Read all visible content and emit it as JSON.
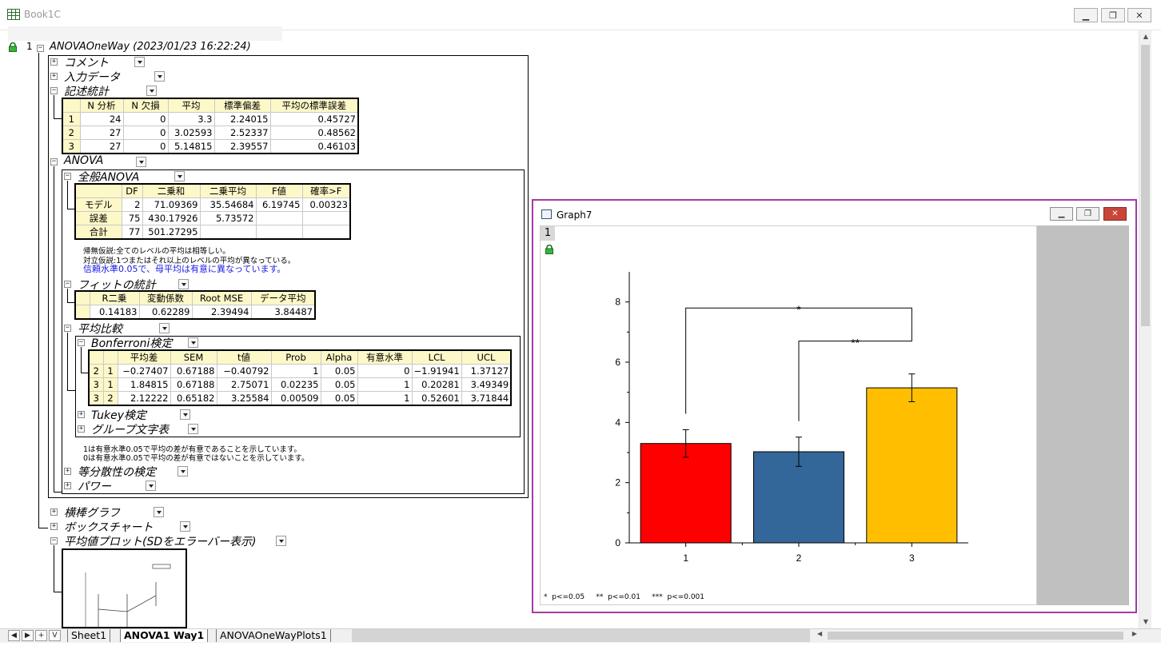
{
  "window": {
    "title": "Book1C"
  },
  "report": {
    "index": "1",
    "title": "ANOVAOneWay (2023/01/23 16:22:24)",
    "nodes": {
      "comment": "コメント",
      "input": "入力データ",
      "descriptive": "記述統計",
      "anova": "ANOVA",
      "overall_anova": "全般ANOVA",
      "fit_stats": "フィットの統計",
      "means_comparison": "平均比較",
      "bonferroni": "Bonferroni検定",
      "tukey": "Tukey検定",
      "group_letters": "グループ文字表",
      "homogeneity": "等分散性の検定",
      "power": "パワー",
      "bar_graph": "横棒グラフ",
      "box_chart": "ボックスチャート",
      "means_plot": "平均値プロット(SDをエラーバー表示)"
    },
    "descriptive_table": {
      "headers": [
        "N 分析",
        "N 欠損",
        "平均",
        "標準偏差",
        "平均の標準誤差"
      ],
      "rows": [
        [
          "1",
          "24",
          "0",
          "3.3",
          "2.24015",
          "0.45727"
        ],
        [
          "2",
          "27",
          "0",
          "3.02593",
          "2.52337",
          "0.48562"
        ],
        [
          "3",
          "27",
          "0",
          "5.14815",
          "2.39557",
          "0.46103"
        ]
      ]
    },
    "anova_table": {
      "headers": [
        "DF",
        "二乗和",
        "二乗平均",
        "F値",
        "確率>F"
      ],
      "rows": [
        [
          "モデル",
          "2",
          "71.09369",
          "35.54684",
          "6.19745",
          "0.00323"
        ],
        [
          "誤差",
          "75",
          "430.17926",
          "5.73572",
          "",
          ""
        ],
        [
          "合計",
          "77",
          "501.27295",
          "",
          "",
          ""
        ]
      ]
    },
    "anova_notes": {
      "null": "帰無仮説:全てのレベルの平均は相等しい。",
      "alt": "対立仮説:1つまたはそれ以上のレベルの平均が異なっている。",
      "conclusion": "信頼水準0.05で、母平均は有意に異なっています。"
    },
    "fit_table": {
      "headers": [
        "R二乗",
        "変動係数",
        "Root MSE",
        "データ平均"
      ],
      "row": [
        "0.14183",
        "0.62289",
        "2.39494",
        "3.84487"
      ]
    },
    "bonferroni_table": {
      "headers": [
        "平均差",
        "SEM",
        "t値",
        "Prob",
        "Alpha",
        "有意水準",
        "LCL",
        "UCL"
      ],
      "rows": [
        [
          "2",
          "1",
          "−0.27407",
          "0.67188",
          "−0.40792",
          "1",
          "0.05",
          "0",
          "−1.91941",
          "1.37127"
        ],
        [
          "3",
          "1",
          "1.84815",
          "0.67188",
          "2.75071",
          "0.02235",
          "0.05",
          "1",
          "0.20281",
          "3.49349"
        ],
        [
          "3",
          "2",
          "2.12222",
          "0.65182",
          "3.25584",
          "0.00509",
          "0.05",
          "1",
          "0.52601",
          "3.71844"
        ]
      ]
    },
    "sig_notes": {
      "line1": "1は有意水準0.05で平均の差が有意であることを示しています。",
      "line2": "0は有意水準0.05で平均の差が有意ではないことを示しています。"
    }
  },
  "sheet_tabs": [
    "Sheet1",
    "ANOVA1 Way1",
    "ANOVAOneWayPlots1"
  ],
  "graph_window": {
    "title": "Graph7",
    "layer": "1",
    "legend_note": "*  p<=0.05     **  p<=0.01     ***  p<=0.001"
  },
  "chart_data": {
    "type": "bar",
    "categories": [
      "1",
      "2",
      "3"
    ],
    "values": [
      3.3,
      3.02593,
      5.14815
    ],
    "errors": [
      0.45727,
      0.48562,
      0.46103
    ],
    "colors": [
      "#ff0000",
      "#336699",
      "#ffbf00"
    ],
    "ylim": [
      0,
      9
    ],
    "yticks": [
      "0",
      "2",
      "4",
      "6",
      "8"
    ],
    "brackets": [
      {
        "from": "1",
        "to": "3",
        "label": "*",
        "y": 7.8
      },
      {
        "from": "2",
        "to": "3",
        "label": "**",
        "y": 6.7
      }
    ],
    "title": "",
    "xlabel": "",
    "ylabel": ""
  }
}
